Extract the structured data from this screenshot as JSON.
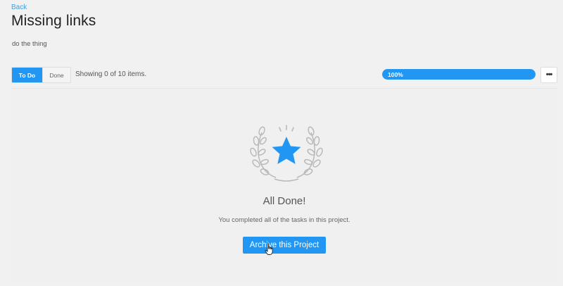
{
  "nav": {
    "back_label": "Back"
  },
  "project": {
    "title": "Missing links",
    "description": "do the thing"
  },
  "toolbar": {
    "tabs": [
      {
        "label": "To Do",
        "active": true
      },
      {
        "label": "Done",
        "active": false
      }
    ],
    "showing_text": "Showing 0 of 10 items.",
    "progress": {
      "percent": 100,
      "label": "100%"
    },
    "more_label": "•••"
  },
  "empty_state": {
    "icon": "laurel-star-icon",
    "title": "All Done!",
    "message": "You completed all of the tasks in this project.",
    "archive_label": "Archive this Project"
  },
  "colors": {
    "accent": "#2196f3",
    "link": "#3aa0e8",
    "background": "#f1f1f1"
  }
}
